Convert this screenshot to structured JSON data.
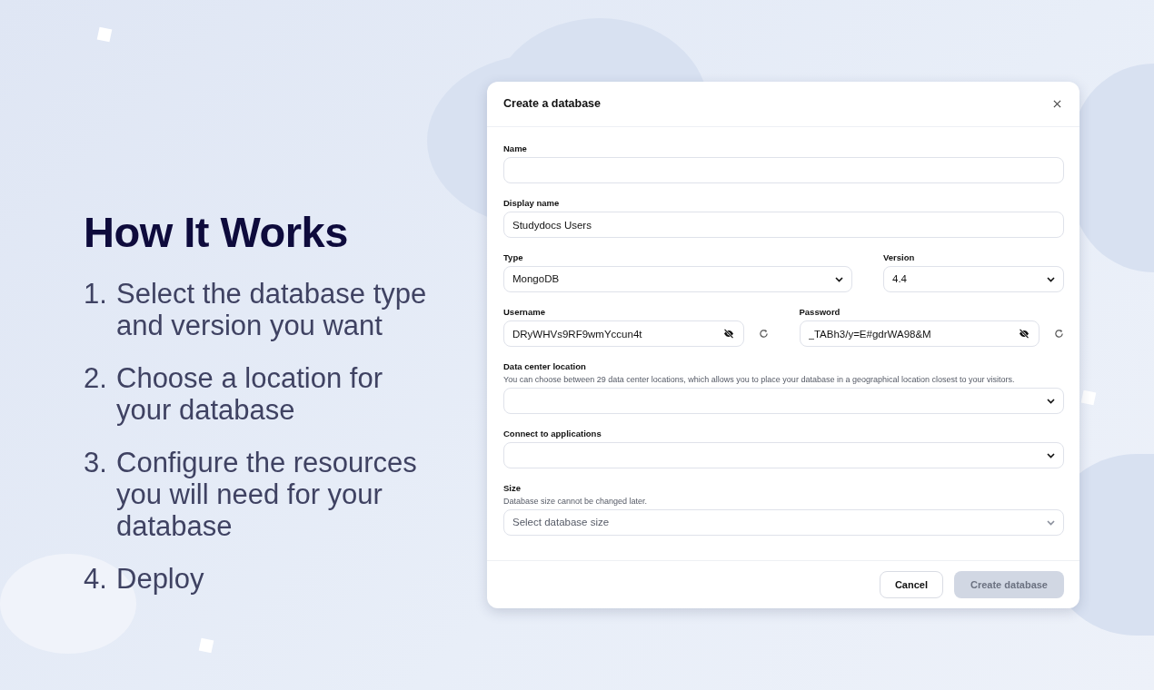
{
  "heading": "How It Works",
  "steps": [
    {
      "number": "1.",
      "text": "Select the database type and version you want"
    },
    {
      "number": "2.",
      "text": "Choose a location for your database"
    },
    {
      "number": "3.",
      "text": "Configure the resources you will need for your database"
    },
    {
      "number": "4.",
      "text": "Deploy"
    }
  ],
  "dialog": {
    "title": "Create a database",
    "rows": [
      [
        {
          "kind": "text",
          "label": "Name"
        }
      ],
      [
        {
          "kind": "text",
          "label": "Display name",
          "value": "Studydocs Users"
        }
      ],
      [
        {
          "kind": "select",
          "label": "Type",
          "value": "MongoDB"
        },
        {
          "kind": "select",
          "label": "Version",
          "value": "4.4"
        }
      ],
      [
        {
          "kind": "secret",
          "label": "Username",
          "value": "DRyWHVs9RF9wmYccun4t"
        },
        {
          "kind": "secret",
          "label": "Password",
          "value": "_TABh3/y=E#gdrWA98&M"
        }
      ],
      [
        {
          "kind": "select",
          "label": "Data center location",
          "hint": "You can choose between 29 data center locations, which allows you to place your database in a geographical location closest to your visitors."
        }
      ],
      [
        {
          "kind": "select",
          "label": "Connect to applications"
        }
      ],
      [
        {
          "kind": "select",
          "label": "Size",
          "hint": "Database size cannot be changed later.",
          "placeholder": "Select database size",
          "disabled": true
        }
      ]
    ],
    "buttons": [
      {
        "label": "Cancel",
        "kind": "secondary",
        "disabled": false
      },
      {
        "label": "Create database",
        "kind": "primary",
        "disabled": true
      }
    ]
  }
}
